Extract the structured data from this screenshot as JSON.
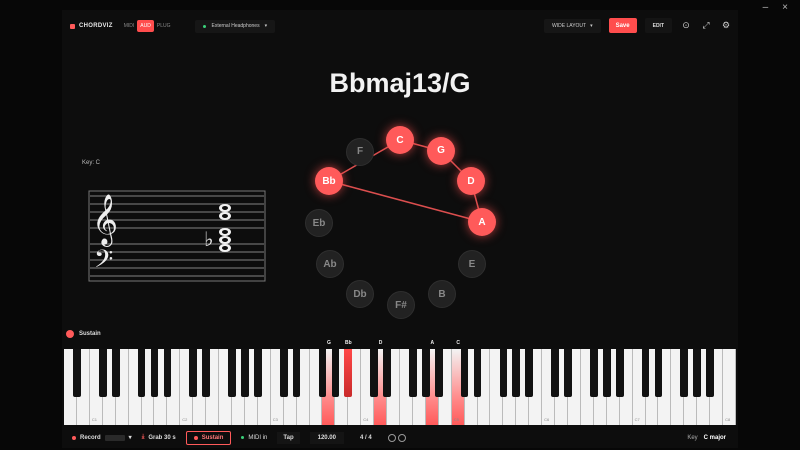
{
  "app": {
    "brand": "CHORDVIZ",
    "modes": [
      "MIDI",
      "AUD",
      "PLUG"
    ],
    "active_mode": "AUD",
    "device": "External Headphones",
    "layout": "WIDE LAYOUT",
    "save_label": "Save",
    "edit_label": "EDIT"
  },
  "window_controls": {
    "minimize": "–",
    "close": "×"
  },
  "chord": {
    "name": "Bbmaj13/G"
  },
  "staff": {
    "key_label": "Key: C"
  },
  "circle_of_fifths": {
    "notes": [
      "C",
      "G",
      "D",
      "A",
      "E",
      "B",
      "F#",
      "Db",
      "Ab",
      "Eb",
      "Bb",
      "F"
    ],
    "active": [
      "C",
      "G",
      "D",
      "A",
      "Bb"
    ],
    "colors": {
      "active": "#ff5a5a",
      "inactive": "#222222",
      "line": "#ff5a5a"
    }
  },
  "sustain": {
    "label": "Sustain"
  },
  "keyboard": {
    "pressed_labels": [
      "G",
      "Bb",
      "D",
      "A",
      "C"
    ],
    "octave_labels": [
      "C1",
      "C2",
      "C3",
      "C4",
      "C5",
      "C6",
      "C7",
      "C8"
    ]
  },
  "bottom_bar": {
    "record": "Record",
    "grab": "Grab 30 s",
    "sustain": "Sustain",
    "midi_in": "MIDI in",
    "tap": "Tap",
    "bpm": "120.00",
    "time_sig": "4 / 4",
    "key_label": "Key",
    "key_value": "C major"
  }
}
